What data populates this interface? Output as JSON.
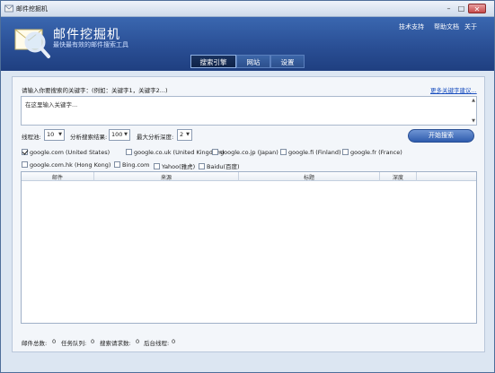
{
  "window": {
    "title": "邮件挖掘机"
  },
  "header": {
    "app_name": "邮件挖掘机",
    "slogan": "最快最有效的邮件搜索工具",
    "links": [
      "技术支持",
      "帮助文档",
      "关于"
    ]
  },
  "tabs": [
    {
      "label": "搜索引擎",
      "active": true
    },
    {
      "label": "网站",
      "active": false
    },
    {
      "label": "设置",
      "active": false
    }
  ],
  "keywords": {
    "label": "请输入你要搜索的关键字：(例如：关键字1，关键字2...)",
    "more_link": "更多关键字建议...",
    "value": "在这里输入关键字..."
  },
  "options": {
    "threads_label": "线程池:",
    "threads_value": "10",
    "results_label": "分析搜索结果:",
    "results_value": "100",
    "depth_label": "最大分析深度:",
    "depth_value": "2"
  },
  "start_button": "开始搜索",
  "engines": [
    {
      "label": "google.com (United States)",
      "checked": true
    },
    {
      "label": "google.co.uk (United Kingdom)",
      "checked": false
    },
    {
      "label": "google.co.jp (Japan)",
      "checked": false
    },
    {
      "label": "google.fi (Finland)",
      "checked": false
    },
    {
      "label": "google.fr (France)",
      "checked": false
    },
    {
      "label": "google.com.hk (Hong Kong)",
      "checked": false
    },
    {
      "label": "Bing.com",
      "checked": false
    },
    {
      "label": "Yahoo(雅虎)",
      "checked": false
    },
    {
      "label": "Baidu(百度)",
      "checked": false
    }
  ],
  "table": {
    "columns": [
      "邮件",
      "来源",
      "标题",
      "深度"
    ]
  },
  "status": {
    "total_label": "邮件总数:",
    "total_value": "0",
    "queue_label": "任务队列:",
    "queue_value": "0",
    "req_label": "搜索请求数:",
    "req_value": "0",
    "bg_label": "后台线程:",
    "bg_value": "0"
  },
  "colors": {
    "banner": "#2a4f95",
    "active_tab": "#0f2247",
    "link": "#1a4fbf",
    "start_button": "#2f5cad"
  }
}
